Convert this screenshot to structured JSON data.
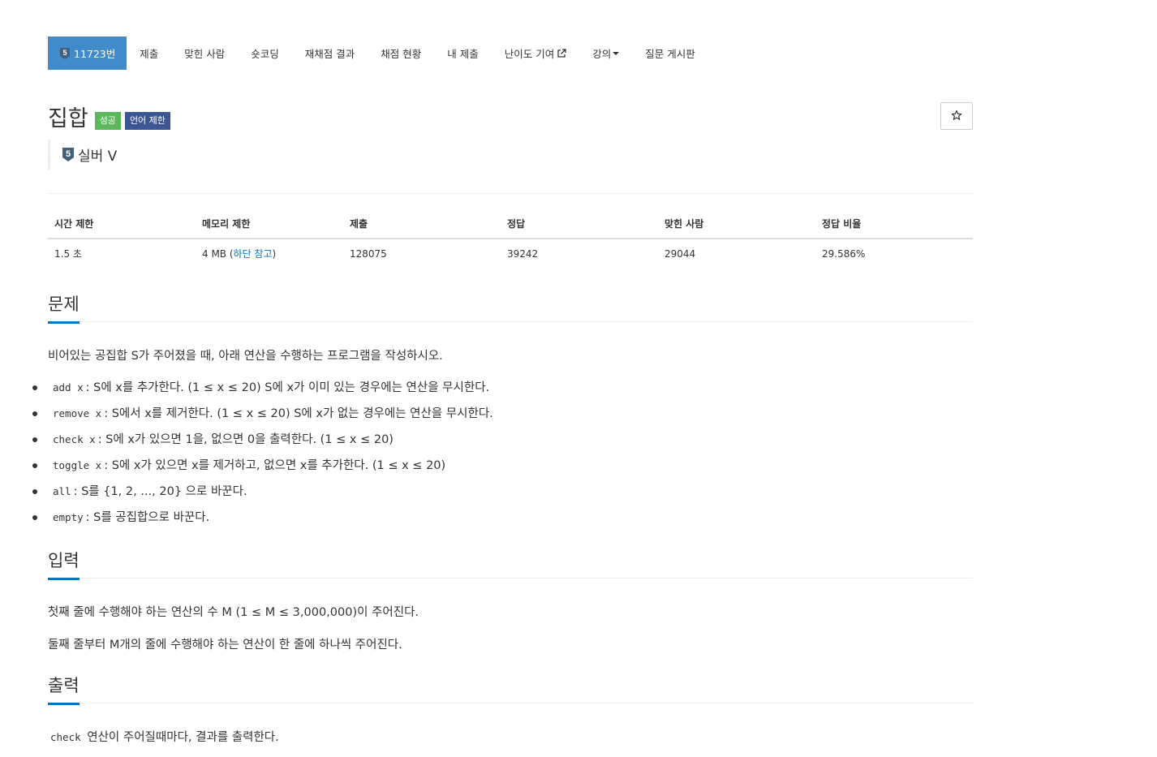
{
  "nav": {
    "tabs": [
      {
        "label": "11723번",
        "tier": "5"
      },
      {
        "label": "제출"
      },
      {
        "label": "맞힌 사람"
      },
      {
        "label": "숏코딩"
      },
      {
        "label": "재채점 결과"
      },
      {
        "label": "채점 현황"
      },
      {
        "label": "내 제출"
      },
      {
        "label": "난이도 기여"
      },
      {
        "label": "강의"
      },
      {
        "label": "질문 게시판"
      }
    ]
  },
  "problem": {
    "title": "집합",
    "label_success": "성공",
    "label_lang": "언어 제한",
    "tier_number": "5",
    "tier_name": "실버 V"
  },
  "info": {
    "headers": [
      "시간 제한",
      "메모리 제한",
      "제출",
      "정답",
      "맞힌 사람",
      "정답 비율"
    ],
    "time": "1.5 초",
    "memory_prefix": "4 MB (",
    "memory_link": "하단 참고",
    "memory_suffix": ")",
    "submissions": "128075",
    "accepted": "39242",
    "solved": "29044",
    "ratio": "29.586%"
  },
  "sections": {
    "problem_title": "문제",
    "problem_text": "비어있는 공집합 S가 주어졌을 때, 아래 연산을 수행하는 프로그램을 작성하시오.",
    "ops": [
      {
        "code": "add x",
        "text": ": S에 x를 추가한다. (1 ≤ x ≤ 20) S에 x가 이미 있는 경우에는 연산을 무시한다."
      },
      {
        "code": "remove x",
        "text": ": S에서 x를 제거한다. (1 ≤ x ≤ 20) S에 x가 없는 경우에는 연산을 무시한다."
      },
      {
        "code": "check x",
        "text": ": S에 x가 있으면 1을, 없으면 0을 출력한다. (1 ≤ x ≤ 20)"
      },
      {
        "code": "toggle x",
        "text": ": S에 x가 있으면 x를 제거하고, 없으면 x를 추가한다. (1 ≤ x ≤ 20)"
      },
      {
        "code": "all",
        "text": ": S를 {1, 2, ..., 20} 으로 바꾼다."
      },
      {
        "code": "empty",
        "text": ": S를 공집합으로 바꾼다."
      }
    ],
    "input_title": "입력",
    "input_line1": "첫째 줄에 수행해야 하는 연산의 수 M (1 ≤ M ≤ 3,000,000)이 주어진다.",
    "input_line2": "둘째 줄부터 M개의 줄에 수행해야 하는 연산이 한 줄에 하나씩 주어진다.",
    "output_title": "출력",
    "output_code": "check",
    "output_text": " 연산이 주어질때마다, 결과를 출력한다."
  },
  "colors": {
    "primary": "#428bca",
    "success": "#5cb85c",
    "lang": "#3c5694",
    "link": "#0076c0",
    "silver": "#435f7a"
  },
  "icons": {
    "tier": "silver-tier-icon",
    "external": "external-link-icon",
    "caret": "caret-down-icon",
    "star": "star-icon"
  }
}
